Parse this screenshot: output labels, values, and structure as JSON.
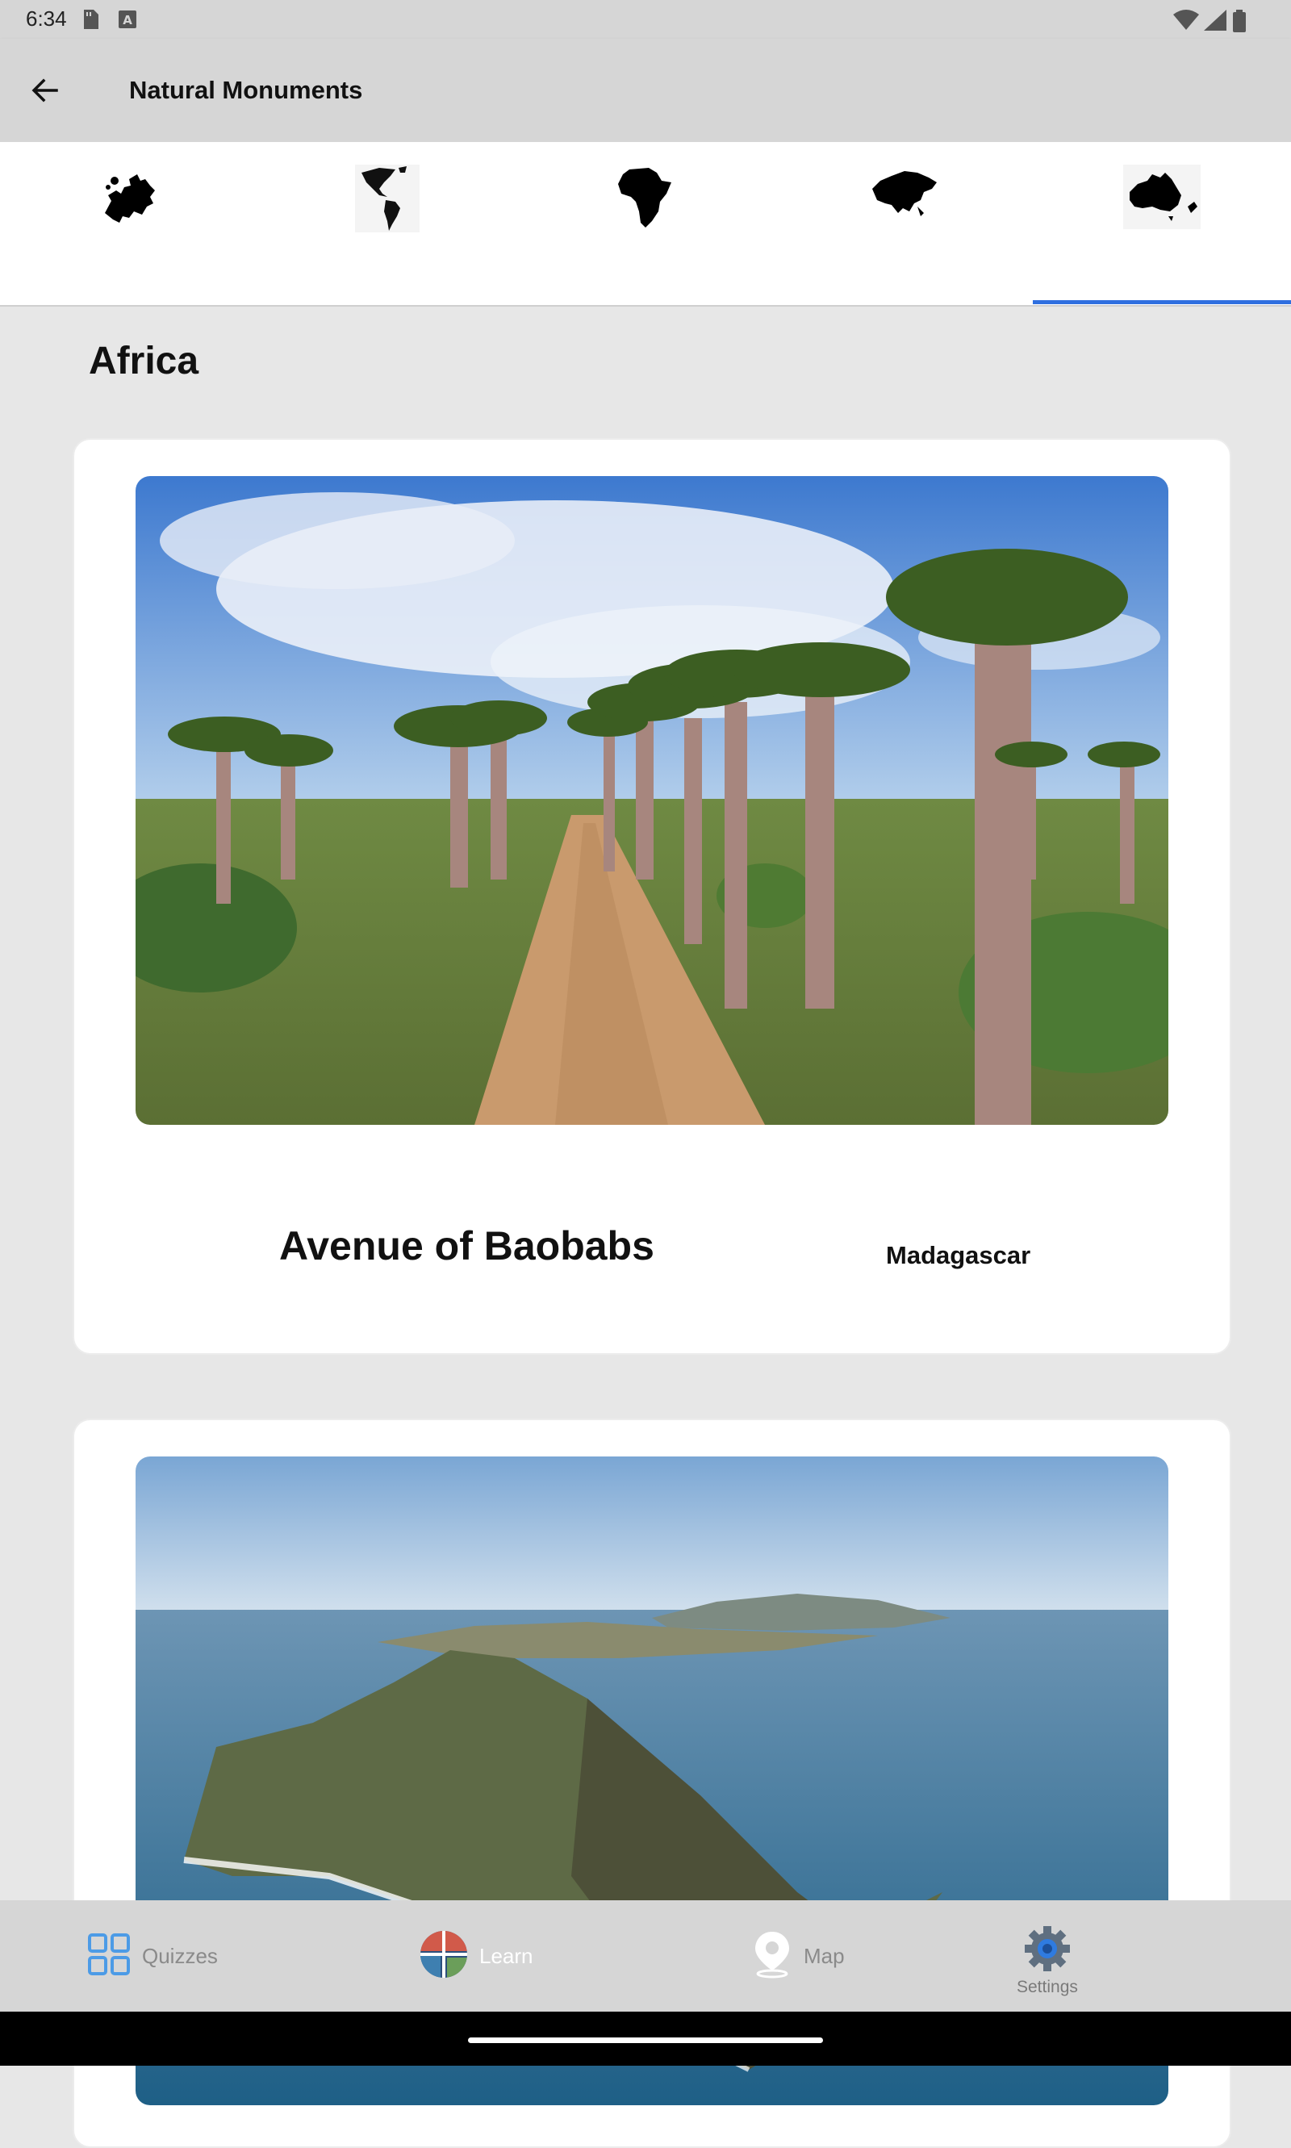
{
  "status_bar": {
    "time": "6:34",
    "icons": [
      "sd-card-icon",
      "keyboard-a-icon",
      "wifi-icon",
      "signal-icon",
      "battery-icon"
    ]
  },
  "app_bar": {
    "title": "Natural Monuments",
    "back_icon": "arrow-back-icon"
  },
  "continent_tabs": {
    "items": [
      {
        "icon": "europe-map-icon",
        "selected": false
      },
      {
        "icon": "americas-map-icon",
        "selected": false
      },
      {
        "icon": "africa-map-icon",
        "selected": false
      },
      {
        "icon": "asia-map-icon",
        "selected": false
      },
      {
        "icon": "australia-map-icon",
        "selected": true
      }
    ],
    "indicator_color": "#2f6fe0"
  },
  "section": {
    "heading": "Africa"
  },
  "cards": [
    {
      "title": "Avenue of Baobabs",
      "country": "Madagascar",
      "image": "baobab-avenue-photo"
    },
    {
      "title": "",
      "country": "",
      "image": "coastal-cape-photo"
    }
  ],
  "bottom_nav": {
    "items": [
      {
        "label": "Quizzes",
        "icon": "grid-icon"
      },
      {
        "label": "Learn",
        "icon": "learn-globe-icon",
        "selected": true
      },
      {
        "label": "Map",
        "icon": "map-pin-icon"
      },
      {
        "label": "Settings",
        "icon": "gear-icon"
      }
    ]
  }
}
